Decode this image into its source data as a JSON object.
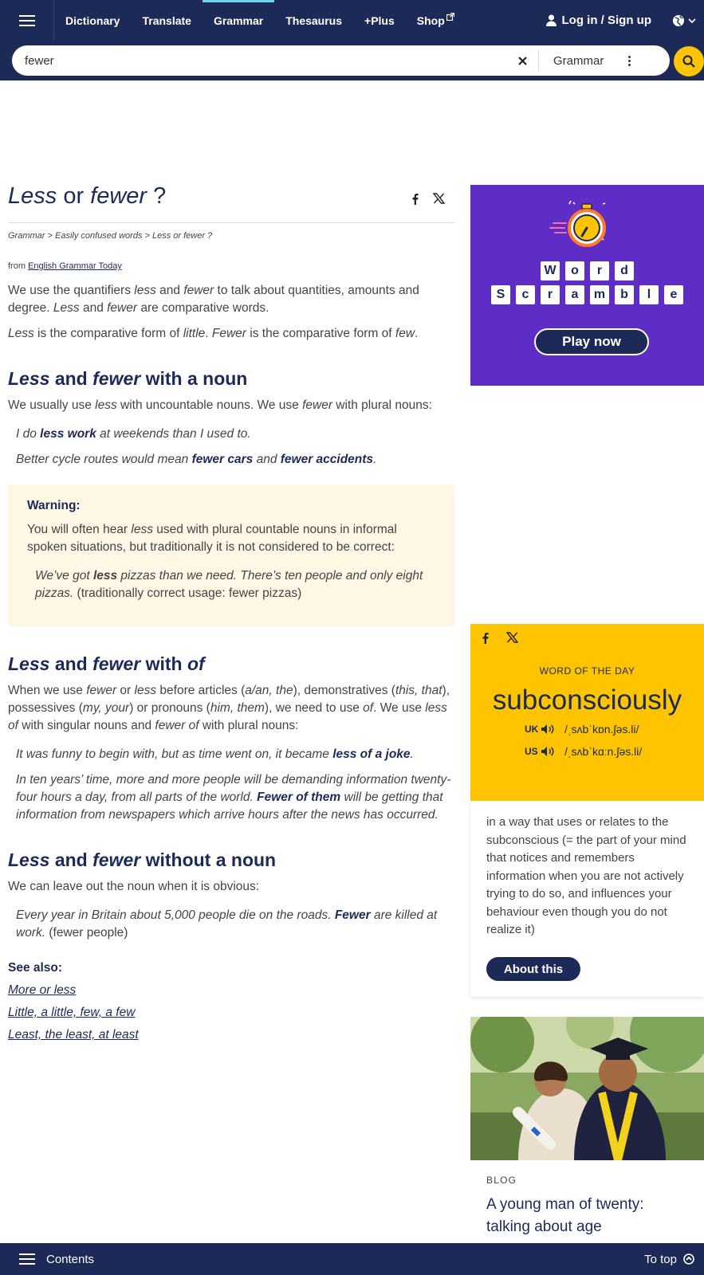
{
  "nav": {
    "links": [
      "Dictionary",
      "Translate",
      "Grammar",
      "Thesaurus",
      "+Plus",
      "Shop"
    ],
    "active": "Grammar",
    "login": "Log in / Sign up"
  },
  "search": {
    "value": "fewer",
    "dictionary": "Grammar"
  },
  "article": {
    "title_a": "Less",
    "title_or": " or ",
    "title_b": "fewer",
    "title_q": " ?",
    "breadcrumb": [
      "Grammar",
      "Easily confused words",
      "Less or fewer ?"
    ],
    "breadcrumb_sep": " > ",
    "from_prefix": "from ",
    "from_link": "English Grammar Today",
    "intro": {
      "p1_a": "We use the quantifiers ",
      "p1_less": "less",
      "p1_and": " and ",
      "p1_fewer": "fewer",
      "p1_b": " to talk about quantities, amounts and degree. ",
      "p1_less2": "Less",
      "p1_and2": " and ",
      "p1_fewer2": "fewer",
      "p1_c": " are comparative words.",
      "p2_less": "Less",
      "p2_a": " is the comparative form of ",
      "p2_little": "little",
      "p2_dot": ". ",
      "p2_fewer": "Fewer",
      "p2_b": " is the comparative form of ",
      "p2_few": "few",
      "p2_end": "."
    },
    "s1": {
      "h_less": "Less",
      "h_and": " and ",
      "h_fewer": "fewer",
      "h_rest": " with a noun",
      "p_a": "We usually use ",
      "p_less": "less",
      "p_b": " with uncountable nouns. We use ",
      "p_fewer": "fewer",
      "p_c": " with plural nouns:",
      "ex1_a": "I do ",
      "ex1_b": "less work",
      "ex1_c": " at weekends than I used to.",
      "ex2_a": "Better cycle routes would mean ",
      "ex2_b": "fewer cars",
      "ex2_c": " and ",
      "ex2_d": "fewer accidents",
      "ex2_e": "."
    },
    "warning": {
      "title": "Warning:",
      "p_a": "You will often hear ",
      "p_less": "less",
      "p_b": " used with plural countable nouns in informal spoken situations, but traditionally it is not considered to be correct:",
      "ex_a": "We’ve got ",
      "ex_b": "less",
      "ex_c": " pizzas than we need. There’s ten people and only eight pizzas.",
      "ex_d": " (traditionally correct usage: fewer pizzas)"
    },
    "s2": {
      "h_less": "Less",
      "h_and": " and ",
      "h_fewer": "fewer",
      "h_with": " with ",
      "h_of": "of",
      "p_a": "When we use ",
      "p_fewer": "fewer",
      "p_or": " or ",
      "p_less": "less",
      "p_b": " before articles (",
      "p_art": "a/an, the",
      "p_c": "), demonstratives (",
      "p_dem": "this, that",
      "p_d": "), possessives (",
      "p_pos": "my, your",
      "p_e": ") or pronouns (",
      "p_pro": "him, them",
      "p_f": "), we need to use ",
      "p_of": "of",
      "p_g": ". We use ",
      "p_lessof": "less of",
      "p_h": " with singular nouns and ",
      "p_fewerof": "fewer of",
      "p_i": " with plural nouns:",
      "ex1_a": "It was funny to begin with, but as time went on, it became ",
      "ex1_b": "less of a joke",
      "ex1_c": ".",
      "ex2_a": "In ten years’ time, more and more people will be demanding information twenty-four hours a day, from all parts of the world. ",
      "ex2_b": "Fewer of them",
      "ex2_c": " will be getting that information from newspapers which arrive hours after the news has occurred."
    },
    "s3": {
      "h_less": "Less",
      "h_and": " and ",
      "h_fewer": "fewer",
      "h_rest": " without a noun",
      "p": "We can leave out the noun when it is obvious:",
      "ex_a": "Every year in Britain about 5,000 people die on the roads. ",
      "ex_b": "Fewer",
      "ex_c": " are killed at work.",
      "ex_d": " (fewer people)"
    },
    "see_also": {
      "title": "See also:",
      "links": [
        "More or less",
        "Little, a little, few, a few",
        "Least, the least, at least"
      ]
    }
  },
  "promo": {
    "row1": [
      "W",
      "o",
      "r",
      "d"
    ],
    "row2": [
      "S",
      "c",
      "r",
      "a",
      "m",
      "b",
      "l",
      "e"
    ],
    "button": "Play now"
  },
  "wotd": {
    "label": "WORD OF THE DAY",
    "word": "subconsciously",
    "uk_label": "UK",
    "uk_pron": "/ˌsʌbˈkɒn.ʃəs.li/",
    "us_label": "US",
    "us_pron": "/ˌsʌbˈkɑːn.ʃəs.li/",
    "definition": "in a way that uses or relates to the subconscious (= the part of your mind that notices and remembers information when you are not actively trying to do so, and influences your behaviour even though you do not realize it)",
    "button": "About this"
  },
  "blog": {
    "kicker": "BLOG",
    "title": "A young man of twenty: talking about age"
  },
  "bottom": {
    "contents": "Contents",
    "totop": "To top"
  },
  "colors": {
    "navy": "#1d2a57",
    "yellow": "#fec400",
    "purple": "#5e2dc5",
    "warning_bg": "#fef7e5",
    "active_tab": "#6fd3f0"
  }
}
